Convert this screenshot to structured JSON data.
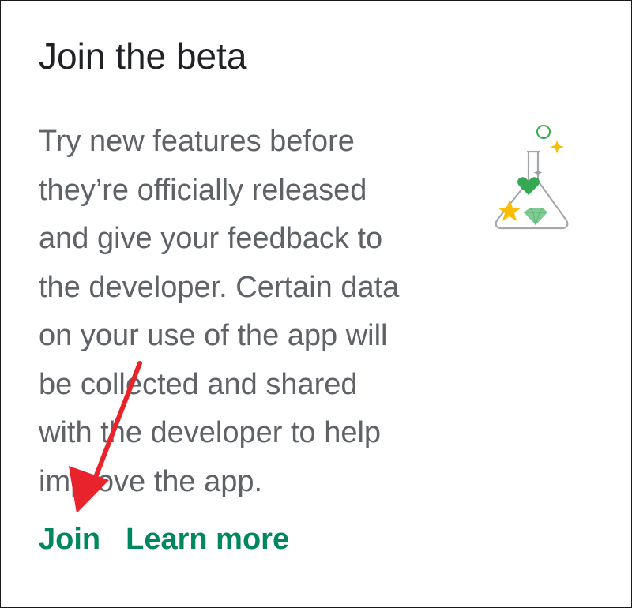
{
  "card": {
    "title": "Join the beta",
    "description_lines": [
      "Try new features before",
      "they’re officially released",
      "and give your feedback to",
      "the developer. Certain data",
      "on your use of the app will",
      "be collected and shared",
      "with the developer to help",
      "improve the app."
    ],
    "illustration_icon": "beta-flask-icon",
    "actions": {
      "join_label": "Join",
      "learn_more_label": "Learn more"
    }
  },
  "annotation": {
    "arrow_icon": "red-arrow-icon",
    "arrow_color": "#e8232b"
  },
  "colors": {
    "accent": "#01875f",
    "title": "#202124",
    "body_text": "#5f6368",
    "heart": "#34a853",
    "star": "#fbbc04"
  }
}
